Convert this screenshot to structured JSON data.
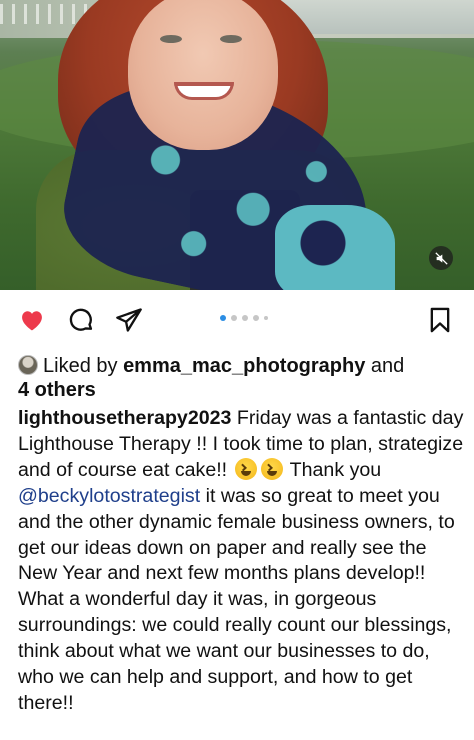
{
  "post": {
    "media": {
      "image_description_icon": "photo",
      "mute_icon": "speaker-muted-icon"
    },
    "actions": {
      "like_icon": "heart-filled-icon",
      "comment_icon": "comment-bubble-icon",
      "share_icon": "paper-plane-icon",
      "save_icon": "bookmark-icon",
      "carousel_dot_count": 5,
      "active_dot_index": 0,
      "like_color": "#ed3a4c",
      "active_dot_color": "#2b8de4"
    },
    "likes": {
      "prefix": "Liked by ",
      "user": "emma_mac_photography",
      "connector": " and",
      "others": "4 others"
    },
    "caption": {
      "username": "lighthousetherapy2023",
      "text_1": " Friday was a fantastic day Lighthouse Therapy !! I took time to plan, strategize and of course eat cake!! ",
      "emoji": "😆",
      "text_2": " Thank you ",
      "mention": "@beckylotostrategist",
      "text_3": " it was so great to meet you and the other dynamic female business owners, to get our ideas down on paper and really see the New Year and next few months plans develop!! What a wonderful day it was, in gorgeous surroundings: we could really count our blessings, think about what we want our businesses to do, who we can help and support, and how to get there!!"
    }
  }
}
